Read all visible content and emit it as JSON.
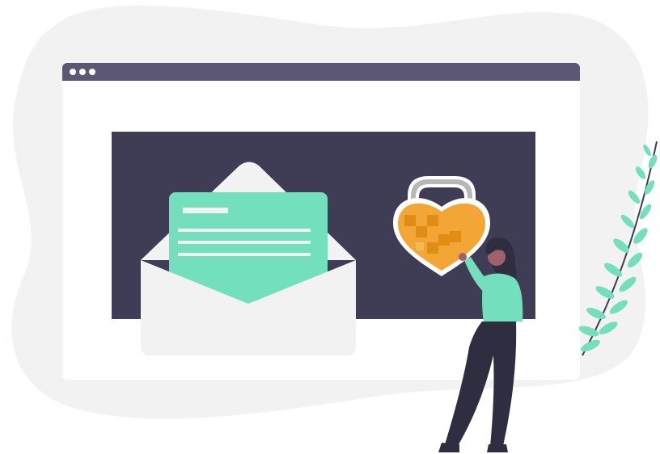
{
  "illustration": {
    "browser_window": {
      "window_controls": [
        "dot",
        "dot",
        "dot"
      ]
    },
    "icons": {
      "envelope": "open-envelope-with-letter",
      "lock": "heart-shaped-padlock",
      "person": "woman-touching-lock",
      "plant": "fern-leaf"
    }
  },
  "colors": {
    "background_blob": "#f2f2f2",
    "browser_titlebar": "#5b5774",
    "browser_body": "#ffffff",
    "screen_panel": "#3f3d56",
    "envelope": "#f2f2f2",
    "envelope_shadow": "#e6e6e6",
    "letter": "#73dfbd",
    "lock_body": "#f3a536",
    "lock_dark": "#e08d16",
    "lock_shackle": "#b7b7b7",
    "person_dark": "#2f2e41",
    "person_skin": "#a0616a",
    "plant": "#73dfbd"
  }
}
